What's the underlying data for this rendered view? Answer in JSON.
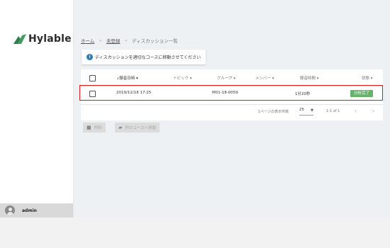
{
  "brand": {
    "name": "Hylable",
    "logo_color": "#2e7d4a"
  },
  "sidebar": {
    "user_name": "admin"
  },
  "breadcrumb": {
    "home": "ホーム",
    "unregistered": "未登録",
    "current": "ディスカッション一覧",
    "separator": "›"
  },
  "notice": {
    "icon": "i",
    "text": "ディスカッションを適切なコースに移動させてください"
  },
  "table": {
    "headers": {
      "recorded_at": "録音日時",
      "topic": "トピック",
      "group": "グループ",
      "members": "メンバー",
      "duration": "録音時間",
      "status": "状態"
    },
    "rows": [
      {
        "recorded_at": "2019/12/18 17:25",
        "group": "M01-18-0059",
        "duration": "1分20秒",
        "status": "分析完了"
      }
    ],
    "pagination": {
      "rows_per_page_label": "1ページの表示件数",
      "rows_per_page": "25",
      "range": "1-1 of 1"
    }
  },
  "actions": {
    "delete": "削除",
    "move": "別のコースへ移動"
  },
  "colors": {
    "accent_green": "#67b26f",
    "highlight_red": "#e01b1b",
    "info_blue": "#2f7db8"
  }
}
